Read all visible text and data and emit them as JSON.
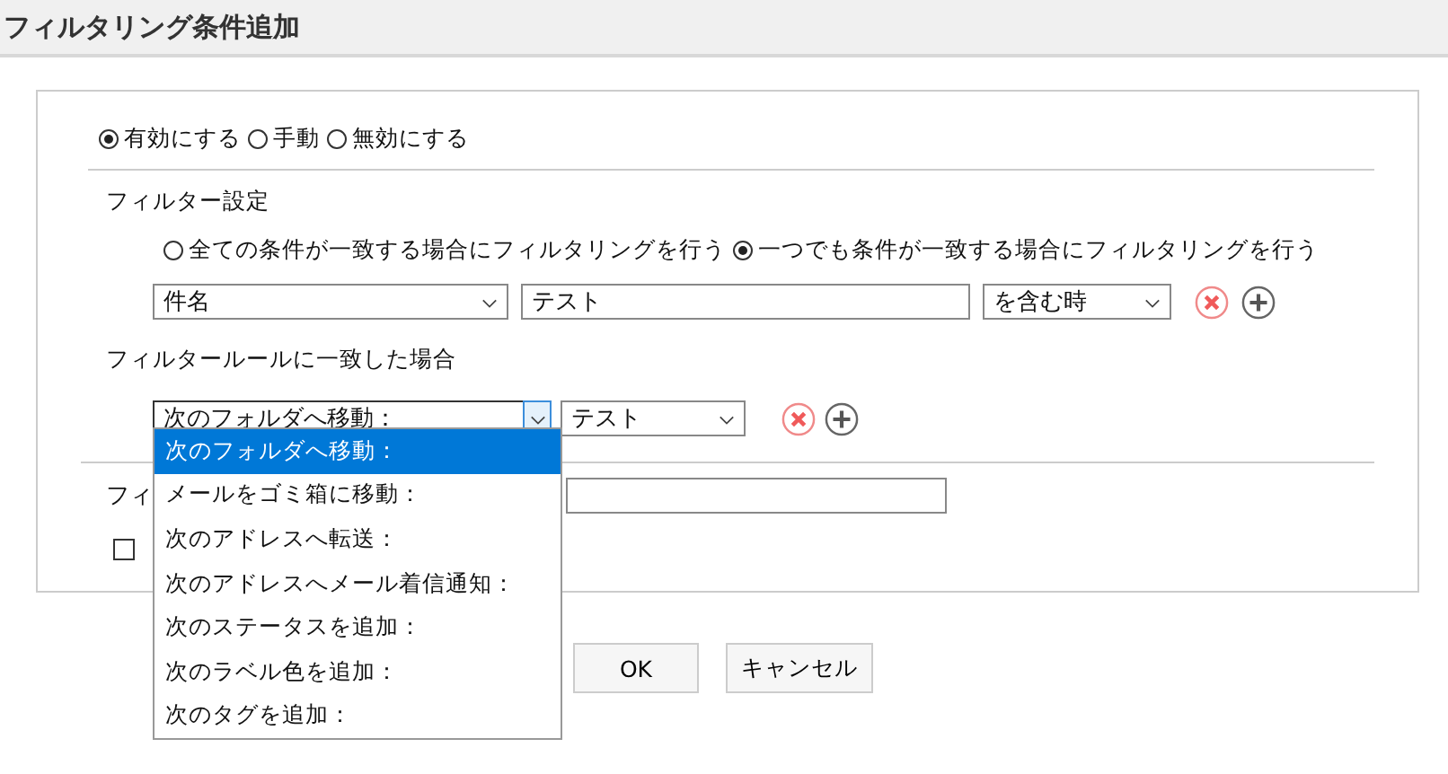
{
  "window": {
    "title": "フィルタリング条件追加"
  },
  "mode_options": [
    {
      "label": "有効にする",
      "selected": true
    },
    {
      "label": "手動",
      "selected": false
    },
    {
      "label": "無効にする",
      "selected": false
    }
  ],
  "filter_settings": {
    "heading": "フィルター設定",
    "match_options": [
      {
        "label": "全ての条件が一致する場合にフィルタリングを行う",
        "selected": false
      },
      {
        "label": "一つでも条件が一致する場合にフィルタリングを行う",
        "selected": true
      }
    ],
    "condition": {
      "field": "件名",
      "value": "テスト",
      "operator": "を含む時"
    }
  },
  "actions": {
    "heading": "フィルタールールに一致した場合",
    "action": {
      "type": "次のフォルダへ移動：",
      "target": "テスト"
    },
    "options": [
      {
        "label": "次のフォルダへ移動：",
        "selected": true
      },
      {
        "label": "メールをゴミ箱に移動：",
        "selected": false
      },
      {
        "label": "次のアドレスへ転送：",
        "selected": false
      },
      {
        "label": "次のアドレスへメール着信通知：",
        "selected": false
      },
      {
        "label": "次のステータスを追加：",
        "selected": false
      },
      {
        "label": "次のラベル色を追加：",
        "selected": false
      },
      {
        "label": "次のタグを追加：",
        "selected": false
      }
    ]
  },
  "name_label": "フィ",
  "checkbox": {
    "checked": false
  },
  "buttons": [
    "OK",
    "キャンセル"
  ]
}
